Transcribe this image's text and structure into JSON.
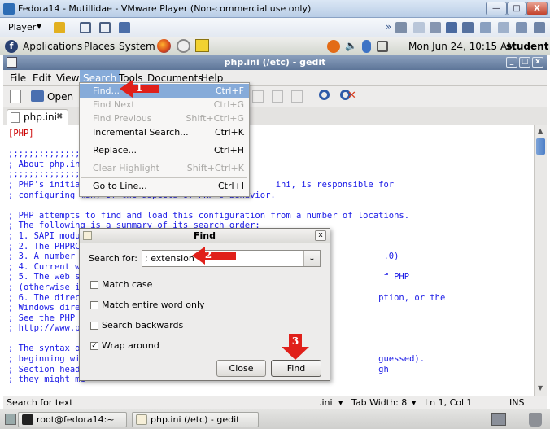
{
  "vmware": {
    "title": "Fedora14 - Mutillidae - VMware Player (Non-commercial use only)",
    "player_menu": "Player",
    "min_label": "—",
    "max_label": "□",
    "close_label": "X"
  },
  "gnome_panel": {
    "logo": "f",
    "applications": "Applications",
    "places": "Places",
    "system": "System",
    "clock": "Mon Jun 24, 10:15 AM",
    "user": "student"
  },
  "gedit": {
    "title": "php.ini (/etc) - gedit",
    "menus": [
      "File",
      "Edit",
      "View",
      "Search",
      "Tools",
      "Documents",
      "Help"
    ],
    "toolbar_open": "Open",
    "tab_label": "php.ini",
    "tab_close": "✖"
  },
  "search_menu": [
    {
      "label": "Find...",
      "accel": "Ctrl+F",
      "enabled": true
    },
    {
      "label": "Find Next",
      "accel": "Ctrl+G",
      "enabled": false
    },
    {
      "label": "Find Previous",
      "accel": "Shift+Ctrl+G",
      "enabled": false
    },
    {
      "label": "Incremental Search...",
      "accel": "Ctrl+K",
      "enabled": true
    },
    {
      "label": "Replace...",
      "accel": "Ctrl+H",
      "enabled": true
    },
    {
      "label": "Clear Highlight",
      "accel": "Shift+Ctrl+K",
      "enabled": false
    },
    {
      "label": "Go to Line...",
      "accel": "Ctrl+I",
      "enabled": true
    }
  ],
  "editor_lines": [
    "[PHP]",
    "",
    ";;;;;;;;;;;;;;;;;;;",
    "; About php.ini",
    ";;;;;;;;;;;;;;;;;;;",
    "; PHP's initial                                     ini, is responsible for",
    "; configuring many of the aspects of PHP's behavior.",
    "",
    "; PHP attempts to find and load this configuration from a number of locations.",
    "; The following is a summary of its search order:",
    "; 1. SAPI modul",
    "; 2. The PHPRC",
    "; 3. A number o                                                          .0)",
    "; 4. Current wo",
    "; 5. The web se                                                          f PHP",
    "; (otherwise in",
    "; 6. The direct                                                         ption, or the",
    "; Windows direc",
    "; See the PHP d",
    "; http://www.ph",
    "",
    "; The syntax of",
    "; beginning wit                                                         guessed).",
    "; Section heade                                                         gh",
    "; they might me"
  ],
  "find_dialog": {
    "title": "Find",
    "search_label": "Search for:",
    "search_value": "; extension",
    "options": [
      {
        "label": "Match case",
        "checked": false
      },
      {
        "label": "Match entire word only",
        "checked": false
      },
      {
        "label": "Search backwards",
        "checked": false
      },
      {
        "label": "Wrap around",
        "checked": true
      }
    ],
    "close_button": "Close",
    "find_button": "Find",
    "close_icon": "x"
  },
  "statusbar": {
    "left": "Search for text",
    "filetype": ".ini",
    "tab_width": "Tab Width:  8",
    "position": "Ln 1, Col 1",
    "mode": "INS"
  },
  "taskbar": {
    "terminal": "root@fedora14:~",
    "gedit": "php.ini (/etc) - gedit"
  },
  "annotations": {
    "step1": "1",
    "step2": "2",
    "step3": "3"
  },
  "colors": {
    "menu_highlight": "#86abd9",
    "callout_red": "#e0201a",
    "comment_blue": "#1a1ae6",
    "section_red": "#cc0000"
  }
}
